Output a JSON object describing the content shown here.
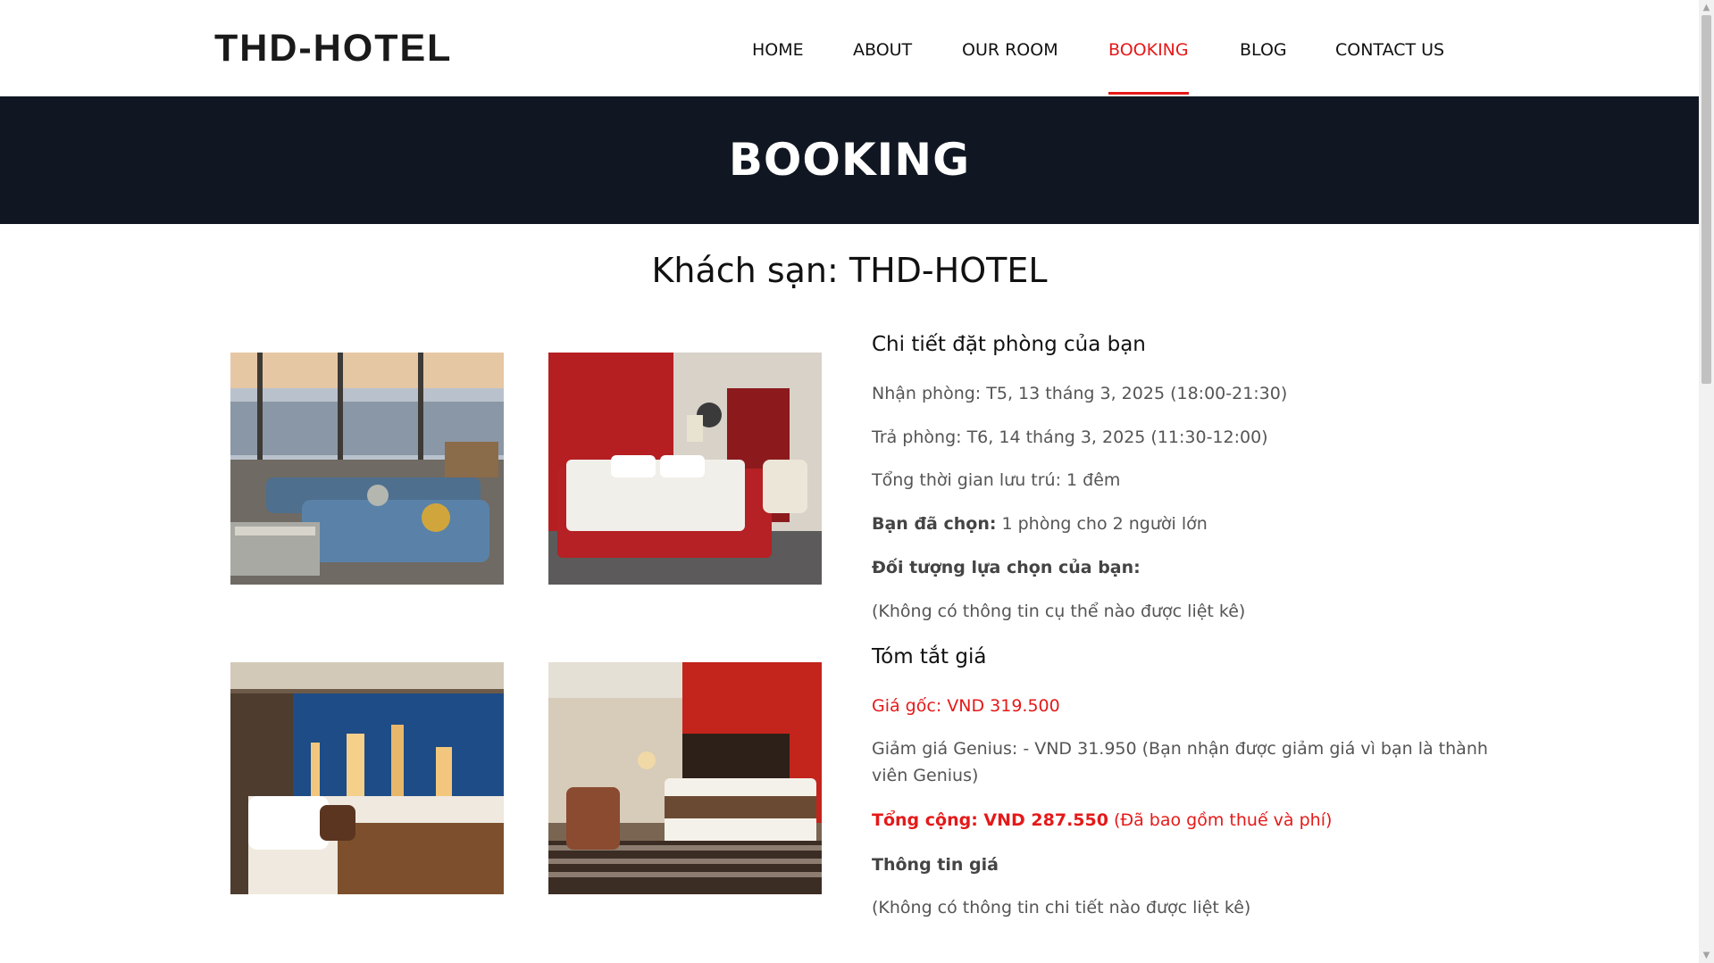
{
  "header": {
    "logo": "THD-HOTEL",
    "nav": [
      {
        "label": "HOME",
        "active": false
      },
      {
        "label": "ABOUT",
        "active": false
      },
      {
        "label": "OUR ROOM",
        "active": false
      },
      {
        "label": "BOOKING",
        "active": true
      },
      {
        "label": "BLOG",
        "active": false
      },
      {
        "label": "CONTACT US",
        "active": false
      }
    ]
  },
  "banner": {
    "title": "BOOKING"
  },
  "main": {
    "hotel_title": "Khách sạn: THD-HOTEL",
    "photos": [
      {
        "icon": "living-room-photo"
      },
      {
        "icon": "red-bedroom-photo"
      },
      {
        "icon": "city-view-bedroom-photo"
      },
      {
        "icon": "red-wall-bedroom-photo"
      }
    ],
    "details": {
      "title": "Chi tiết đặt phòng của bạn",
      "checkin": "Nhận phòng: T5, 13 tháng 3, 2025 (18:00-21:30)",
      "checkout": "Trả phòng: T6, 14 tháng 3, 2025 (11:30-12:00)",
      "duration": "Tổng thời gian lưu trú: 1 đêm",
      "selected_label": "Bạn đã chọn:",
      "selected_value": " 1 phòng cho 2 người lớn",
      "target_label": "Đối tượng lựa chọn của bạn:",
      "target_value": "(Không có thông tin cụ thể nào được liệt kê)"
    },
    "price": {
      "title": "Tóm tắt giá",
      "original": "Giá gốc: VND 319.500",
      "discount": "Giảm giá Genius: - VND 31.950 (Bạn nhận được giảm giá vì bạn là thành viên Genius)",
      "total_label": "Tổng cộng: VND 287.550",
      "total_note": " (Đã bao gồm thuế và phí)",
      "info_label": "Thông tin giá",
      "info_value": "(Không có thông tin chi tiết nào được liệt kê)"
    }
  },
  "colors": {
    "accent": "#e51919",
    "banner_bg": "#111722",
    "text": "#111111",
    "muted": "#555555"
  }
}
